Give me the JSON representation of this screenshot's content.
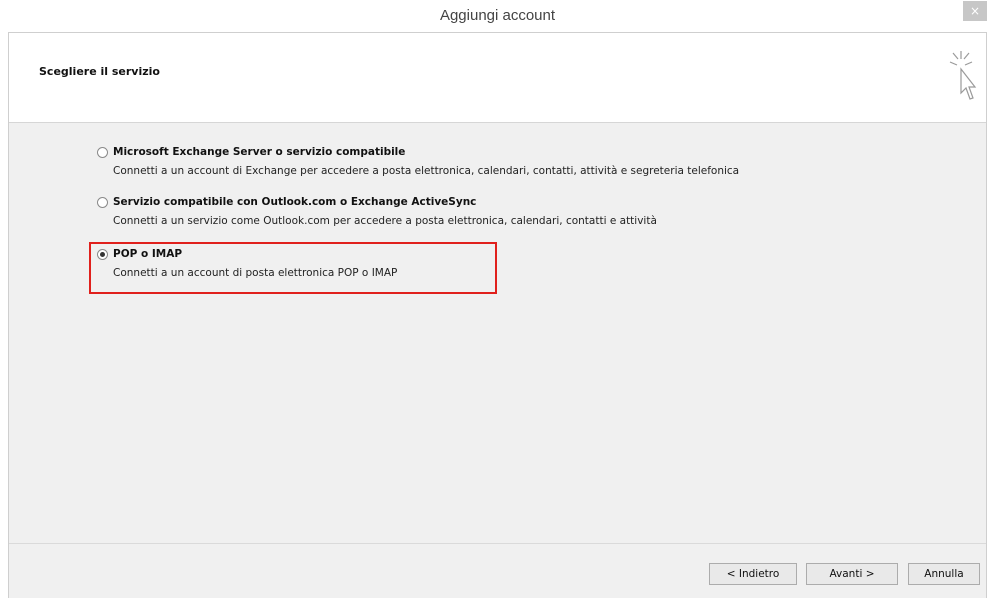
{
  "window": {
    "title": "Aggiungi account",
    "close_label": "×"
  },
  "header": {
    "title": "Scegliere il servizio",
    "icon": "cursor-click-icon"
  },
  "options": [
    {
      "label": "Microsoft Exchange Server o servizio compatibile",
      "description": "Connetti a un account di Exchange per accedere a posta elettronica, calendari, contatti, attività e segreteria telefonica",
      "selected": false
    },
    {
      "label": "Servizio compatibile con Outlook.com o Exchange ActiveSync",
      "description": "Connetti a un servizio come Outlook.com per accedere a posta elettronica, calendari, contatti e attività",
      "selected": false
    },
    {
      "label": "POP o IMAP",
      "description": "Connetti a un account di posta elettronica POP o IMAP",
      "selected": true
    }
  ],
  "buttons": {
    "back": "< Indietro",
    "next": "Avanti >",
    "cancel": "Annulla"
  },
  "colors": {
    "highlight": "#e0201c",
    "content_bg": "#f0f0f0"
  }
}
